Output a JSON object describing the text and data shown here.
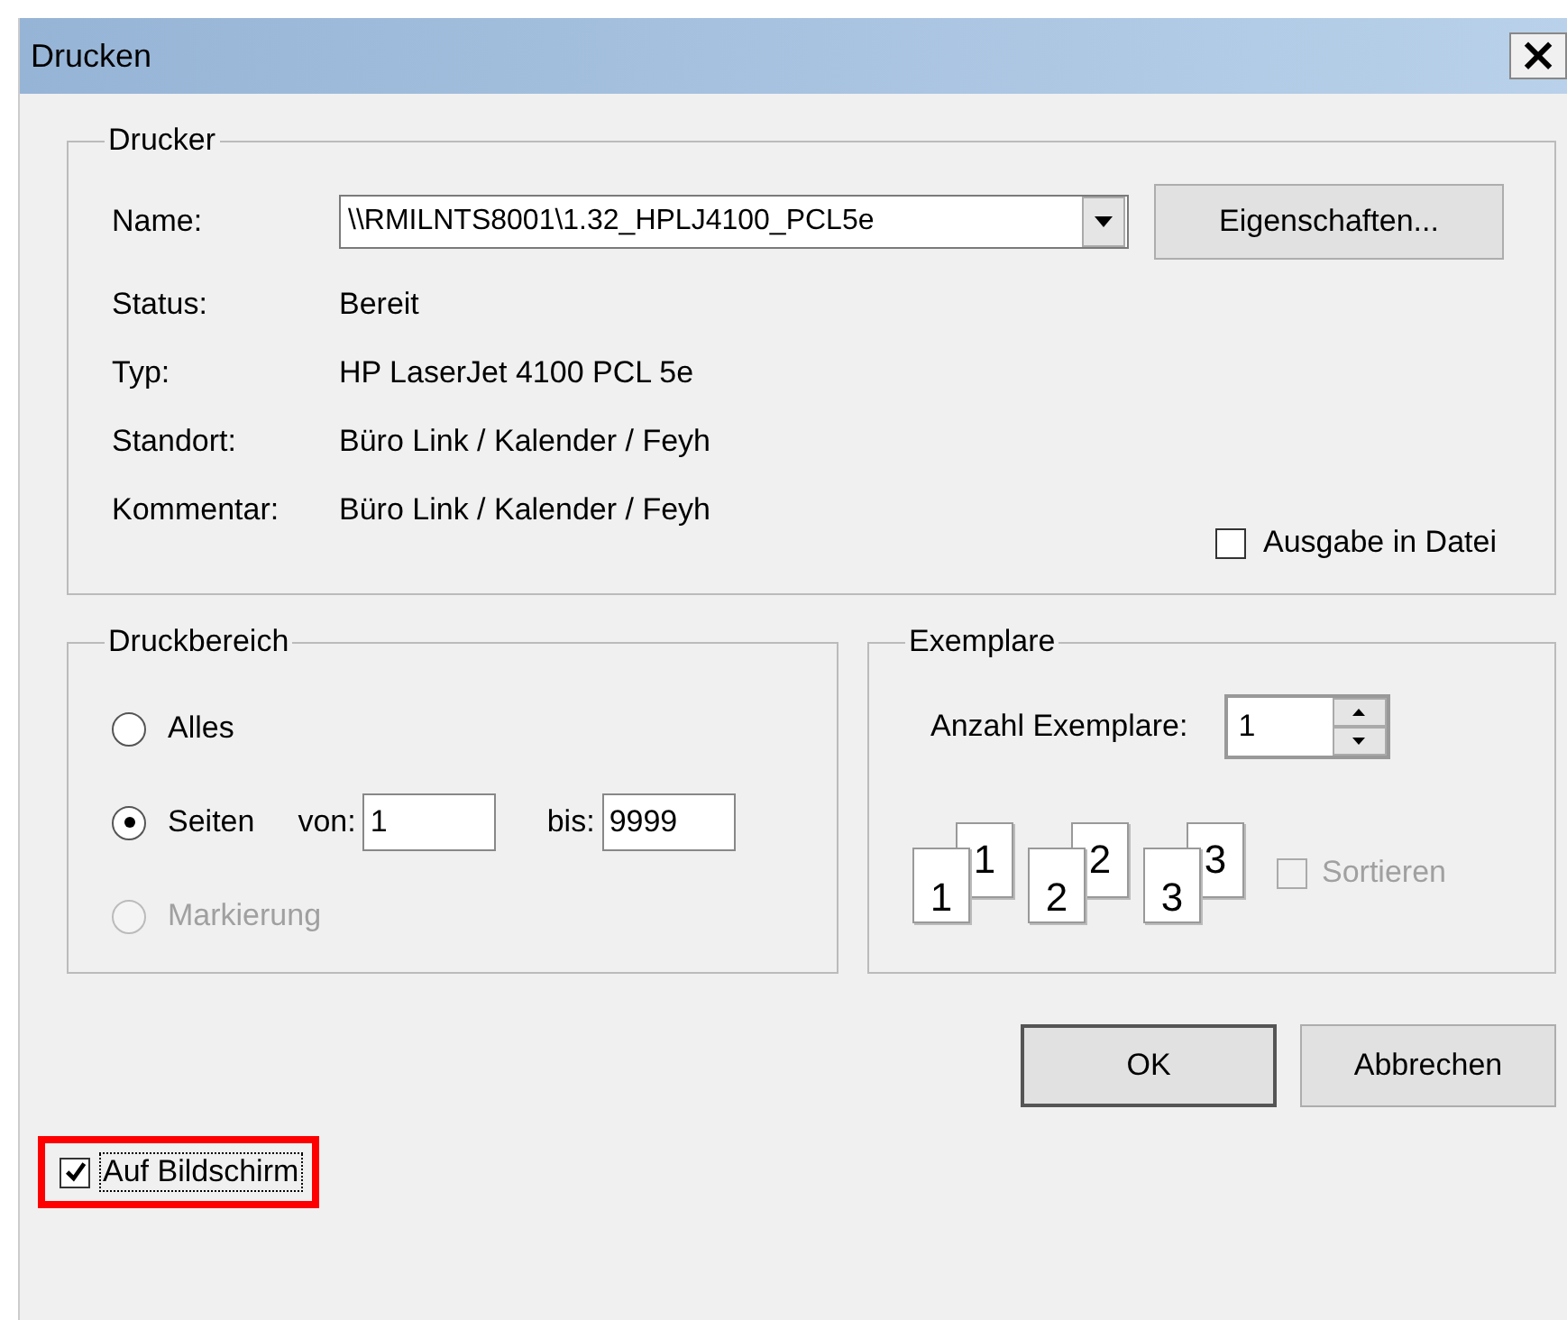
{
  "window": {
    "title": "Drucken",
    "close": "×"
  },
  "printer": {
    "title": "Drucker",
    "name_label": "Name:",
    "name_value": "\\\\RMILNTS8001\\1.32_HPLJ4100_PCL5e",
    "properties_button": "Eigenschaften...",
    "info": [
      {
        "label": "Status:",
        "value": "Bereit"
      },
      {
        "label": "Typ:",
        "value": "HP LaserJet 4100 PCL 5e"
      },
      {
        "label": "Standort:",
        "value": "Büro Link / Kalender / Feyh"
      },
      {
        "label": "Kommentar:",
        "value": "Büro Link / Kalender / Feyh"
      }
    ],
    "print_to_file": {
      "text": "Ausgabe in Datei",
      "checked": false
    }
  },
  "range": {
    "title": "Druckbereich",
    "options": [
      {
        "text": "Alles",
        "selected": false,
        "disabled": false
      },
      {
        "text": "Seiten",
        "selected": true,
        "disabled": false
      },
      {
        "text": "Markierung",
        "selected": false,
        "disabled": true
      }
    ],
    "from_label": "von:",
    "from_value": "1",
    "to_label": "bis:",
    "to_value": "9999"
  },
  "copies": {
    "title": "Exemplare",
    "count_label": "Anzahl Exemplare:",
    "count_value": "1",
    "collate_pages": [
      {
        "back": "1",
        "front": "1"
      },
      {
        "back": "2",
        "front": "2"
      },
      {
        "back": "3",
        "front": "3"
      }
    ],
    "collate": {
      "text": "Sortieren",
      "checked": false,
      "disabled": true
    }
  },
  "buttons": [
    {
      "text": "OK",
      "default": true
    },
    {
      "text": "Abbrechen",
      "default": false
    }
  ],
  "on_screen": {
    "text": "Auf Bildschirm",
    "checked": true,
    "highlighted": true
  }
}
